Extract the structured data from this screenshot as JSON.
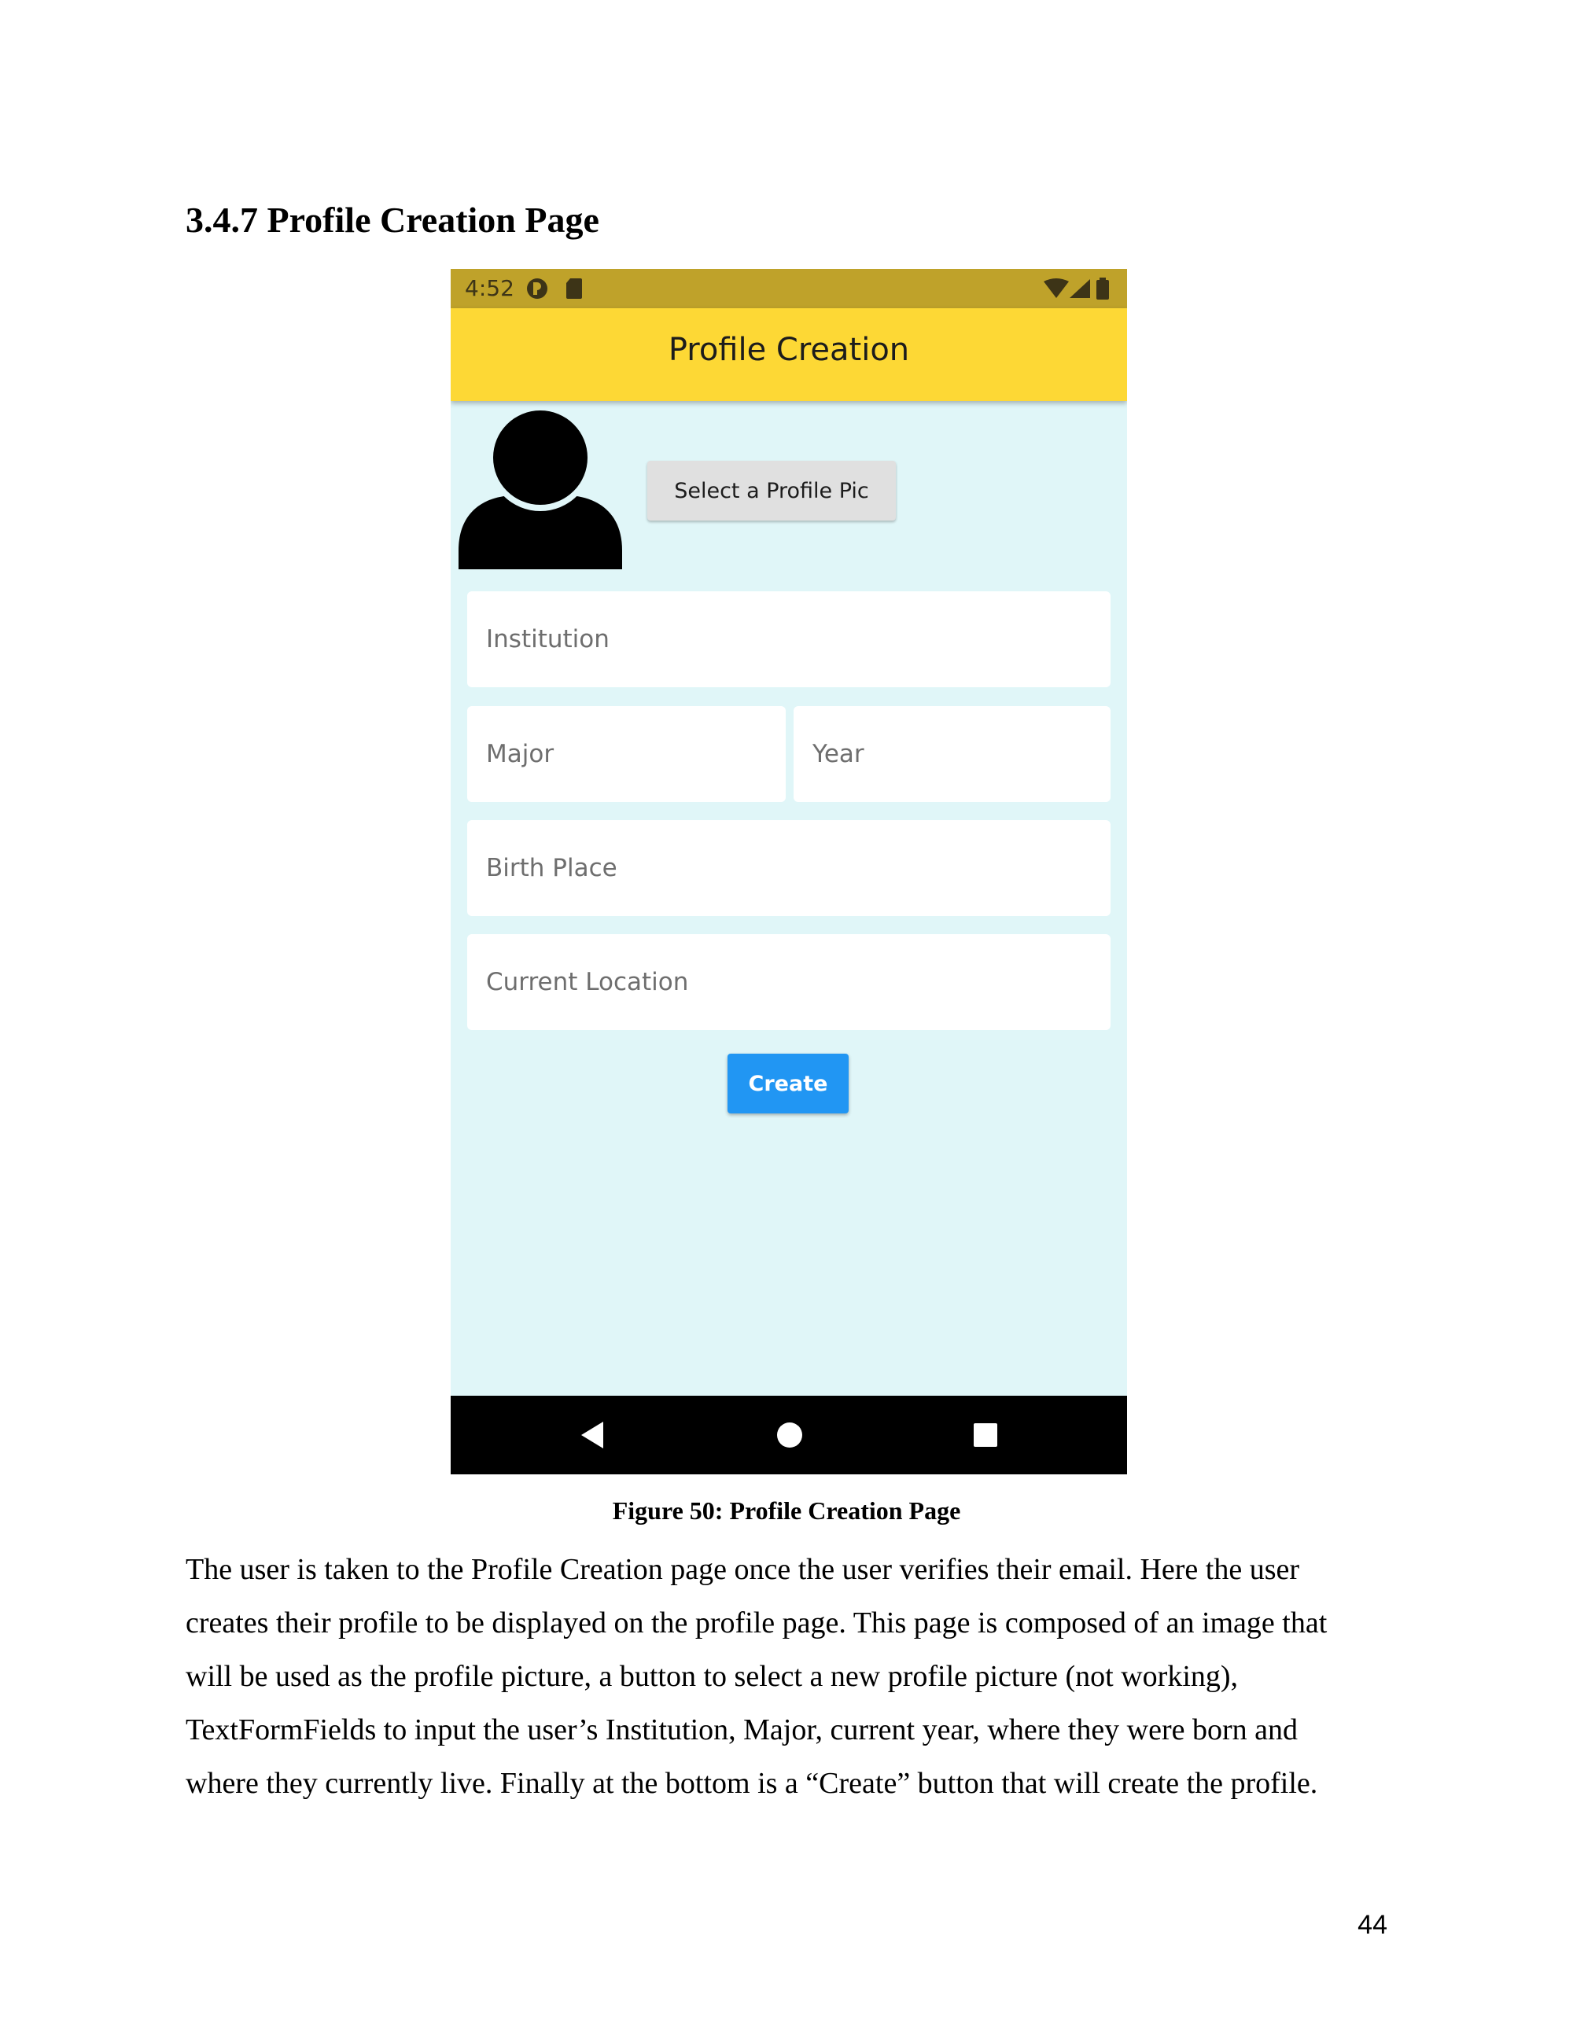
{
  "section": {
    "heading": "3.4.7 Profile Creation Page"
  },
  "phone": {
    "status_bar": {
      "time": "4:52",
      "left_icons": [
        "media-player-icon",
        "sd-card-icon"
      ],
      "right_icons": [
        "wifi-icon",
        "cell-signal-icon",
        "battery-icon"
      ],
      "color": "#bfa22a"
    },
    "app_bar": {
      "title": "Profile Creation",
      "color": "#fdd835"
    },
    "background_color": "#e0f6f8",
    "avatar_icon": "person-icon",
    "select_pic_button": "Select a Profile Pic",
    "fields": {
      "institution": {
        "value": "",
        "placeholder": "Institution"
      },
      "major": {
        "value": "",
        "placeholder": "Major"
      },
      "year": {
        "value": "",
        "placeholder": "Year"
      },
      "birth_place": {
        "value": "",
        "placeholder": "Birth Place"
      },
      "current_location": {
        "value": "",
        "placeholder": "Current Location"
      }
    },
    "create_button": "Create",
    "create_button_color": "#2196f3",
    "nav_bar": {
      "buttons": [
        "back-triangle-icon",
        "home-circle-icon",
        "recents-square-icon"
      ]
    }
  },
  "caption": "Figure 50: Profile Creation Page",
  "body_lines": [
    "The user is taken to the Profile Creation page once the user verifies their email. Here the user",
    "creates their profile to be displayed on the profile page. This page is composed of an image that",
    "will be used as the profile picture, a button to select a new profile picture (not working),",
    "TextFormFields to input the user’s Institution, Major, current year, where they were born and",
    "where they currently live. Finally at the bottom is a “Create” button that will create the profile."
  ],
  "page_number": "44"
}
